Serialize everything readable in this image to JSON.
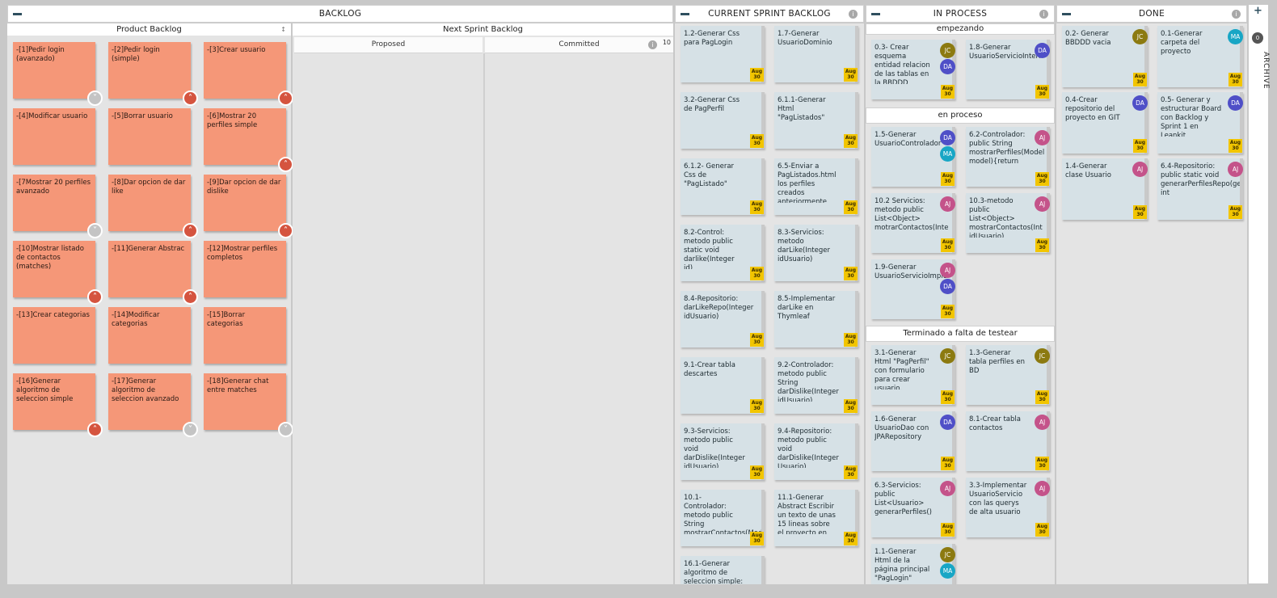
{
  "columns": {
    "backlog": {
      "title": "BACKLOG",
      "product_backlog": "Product Backlog",
      "next_sprint": "Next Sprint Backlog",
      "proposed": "Proposed",
      "committed": "Committed",
      "committed_count": "10"
    },
    "sprint": {
      "title": "CURRENT SPRINT BACKLOG"
    },
    "inprocess": {
      "title": "IN PROCESS",
      "lanes": [
        "empezando",
        "en proceso",
        "Terminado a falta de testear"
      ]
    },
    "done": {
      "title": "DONE"
    }
  },
  "archive": {
    "label": "ARCHIVE",
    "count": "0"
  },
  "date_badge": {
    "month": "Aug",
    "day": "30"
  },
  "avatar_colors": {
    "JC": "#8c7a10",
    "DA": "#4f4fc7",
    "MA": "#18a6c5",
    "AJ": "#c4538a"
  },
  "product_backlog_cards": [
    {
      "text": "-[1]Pedir login (avanzado)",
      "chev": "down"
    },
    {
      "text": "-[2]Pedir login (simple)",
      "chev": "up"
    },
    {
      "text": "-[3]Crear usuario",
      "chev": "up"
    },
    {
      "text": "-[4]Modificar usuario",
      "chev": ""
    },
    {
      "text": "-[5]Borrar usuario",
      "chev": ""
    },
    {
      "text": "-[6]Mostrar 20 perfiles simple",
      "chev": "up"
    },
    {
      "text": "-[7Mostrar 20 perfiles avanzado",
      "chev": "down"
    },
    {
      "text": "-[8]Dar opcion de dar like",
      "chev": "up"
    },
    {
      "text": "-[9]Dar opcion de dar dislike",
      "chev": "up"
    },
    {
      "text": "-[10]Mostrar listado de contactos (matches)",
      "chev": "up"
    },
    {
      "text": "-[11]Generar Abstrac",
      "chev": "up"
    },
    {
      "text": "-[12]Mostrar perfiles completos",
      "chev": ""
    },
    {
      "text": "-[13]Crear categorias",
      "chev": ""
    },
    {
      "text": "-[14]Modificar categorias",
      "chev": ""
    },
    {
      "text": "-[15]Borrar categorias",
      "chev": ""
    },
    {
      "text": "-[16]Generar algoritmo de seleccion simple",
      "chev": "up"
    },
    {
      "text": "-[17]Generar algoritmo de seleccion avanzado",
      "chev": "down"
    },
    {
      "text": "-[18]Generar chat entre matches",
      "chev": "down"
    }
  ],
  "sprint_cards": [
    {
      "text": "1.2-Generar Css para PagLogin",
      "avatars": []
    },
    {
      "text": "1.7-Generar UsuarioDominio",
      "avatars": []
    },
    {
      "text": "3.2-Generar Css de PagPerfil",
      "avatars": []
    },
    {
      "text": "6.1.1-Generar Html \"PagListados\"",
      "avatars": []
    },
    {
      "text": "6.1.2- Generar Css de \"PagListado\"",
      "avatars": []
    },
    {
      "text": "6.5-Enviar a PagListados.html los perfiles creados anteriormente con",
      "avatars": []
    },
    {
      "text": "8.2-Control: metodo public static void darlike(Integer id)",
      "avatars": []
    },
    {
      "text": "8.3-Servicios: metodo darLike(Integer idUsuario)",
      "avatars": []
    },
    {
      "text": "8.4-Repositorio: darLikeRepo(Integer idUsuario)",
      "avatars": []
    },
    {
      "text": "8.5-Implementar darLike en Thymleaf",
      "avatars": []
    },
    {
      "text": "9.1-Crear tabla descartes",
      "avatars": []
    },
    {
      "text": "9.2-Controlador: metodo public String darDislike(Integer idUsuario)",
      "avatars": []
    },
    {
      "text": "9.3-Servicios: metodo public void darDislike(Integer idUsuario)",
      "avatars": []
    },
    {
      "text": "9.4-Repositorio: metodo public void darDislike(Integer Usuario)",
      "avatars": []
    },
    {
      "text": "10.1-Controlador: metodo public String mostrarContactos(Model model)",
      "avatars": []
    },
    {
      "text": "11.1-Generar Abstract Escribir un texto de unas 15 lineas sobre el proyecto en Ingles",
      "avatars": []
    },
    {
      "text": "16.1-Generar algoritmo de seleccion simple: crear metodo public",
      "avatars": []
    }
  ],
  "inprocess_cards": [
    {
      "text": "0.3- Crear esquema entidad relacion de las tablas en la BBDDD",
      "avatars": [
        "JC",
        "DA"
      ]
    },
    {
      "text": "1.8-Generar UsuarioServicioInterf",
      "avatars": [
        "DA"
      ]
    },
    {
      "text": "1.5-Generar UsuarioControlador",
      "avatars": [
        "DA",
        "MA"
      ]
    },
    {
      "text": "6.2-Controlador: public String mostrarPerfiles(Model model){return",
      "avatars": [
        "AJ"
      ]
    },
    {
      "text": "10.2 Servicios: metodo public List<Object> motrarContactos(Inte",
      "avatars": [
        "AJ"
      ]
    },
    {
      "text": "10.3-metodo public List<Object> mostrarContactos(Int idUsuario)",
      "avatars": [
        "AJ"
      ]
    },
    {
      "text": "1.9-Generar UsuarioServicioImple",
      "avatars": [
        "AJ",
        "DA"
      ]
    },
    {
      "text": "3.1-Generar Html \"PagPerfil\" con formulario para crear usuario.",
      "avatars": [
        "JC"
      ]
    },
    {
      "text": "1.3-Generar tabla perfiles en BD",
      "avatars": [
        "JC"
      ]
    },
    {
      "text": "1.6-Generar UsuarioDao con JPARepository",
      "avatars": [
        "DA"
      ]
    },
    {
      "text": "8.1-Crear tabla contactos",
      "avatars": [
        "AJ"
      ]
    },
    {
      "text": "6.3-Servicios: public List<Usuario> generarPerfiles()",
      "avatars": [
        "AJ"
      ]
    },
    {
      "text": "3.3-Implementar UsuarioServicio con las querys de alta usuario",
      "avatars": [
        "AJ"
      ]
    },
    {
      "text": "1.1-Generar Html de la página principal \"PagLogin\"",
      "avatars": [
        "JC",
        "MA"
      ]
    }
  ],
  "done_cards": [
    {
      "text": "0.2- Generar BBDDD vacia",
      "avatars": [
        "JC"
      ]
    },
    {
      "text": "0.1-Generar carpeta del proyecto",
      "avatars": [
        "MA"
      ]
    },
    {
      "text": "0.4-Crear repositorio del proyecto en GIT",
      "avatars": [
        "DA"
      ]
    },
    {
      "text": "0.5- Generar y estructurar Board con Backlog y Sprint 1 en Leankit",
      "avatars": [
        "DA"
      ]
    },
    {
      "text": "1.4-Generar clase Usuario",
      "avatars": [
        "AJ"
      ]
    },
    {
      "text": "6.4-Repositorio: public static void generarPerfilesRepo(genero, int",
      "avatars": [
        "AJ"
      ]
    }
  ]
}
